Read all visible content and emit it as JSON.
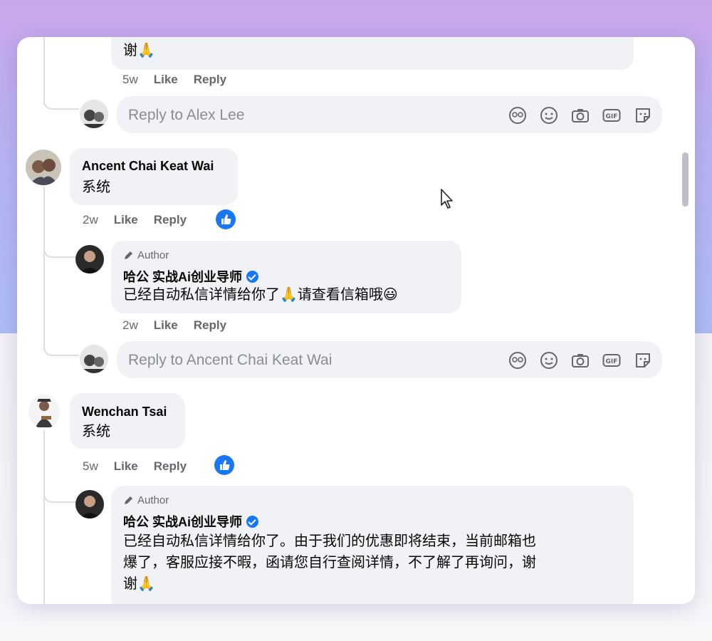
{
  "top_comment": {
    "text_tail": "谢🙏",
    "time": "5w",
    "like_label": "Like",
    "reply_label": "Reply"
  },
  "reply_box_1": {
    "placeholder": "Reply to Alex Lee"
  },
  "comment_1": {
    "author": "Ancent Chai Keat Wai",
    "text": "系统",
    "time": "2w",
    "like_label": "Like",
    "reply_label": "Reply"
  },
  "reply_1": {
    "author_tag": "Author",
    "author": "哈公 实战Ai创业导师",
    "text": "已经自动私信详情给你了🙏请查看信箱哦😃",
    "time": "2w",
    "like_label": "Like",
    "reply_label": "Reply"
  },
  "reply_box_2": {
    "placeholder": "Reply to Ancent Chai Keat Wai"
  },
  "comment_2": {
    "author": "Wenchan Tsai",
    "text": "系统",
    "time": "5w",
    "like_label": "Like",
    "reply_label": "Reply"
  },
  "reply_2": {
    "author_tag": "Author",
    "author": "哈公 实战Ai创业导师",
    "line1": "已经自动私信详情给你了。由于我们的优惠即将结束，当前邮箱也",
    "line2": "爆了，客服应接不暇，函请您自行查阅详情，不了解了再询问，谢",
    "line3": "谢🙏"
  },
  "toolbar_icons": [
    "avatar-sticker-icon",
    "emoji-icon",
    "camera-icon",
    "gif-icon",
    "sticker-icon"
  ],
  "colors": {
    "accent": "#1877f2",
    "bubble": "#f0f2f5",
    "meta": "#65676b"
  }
}
